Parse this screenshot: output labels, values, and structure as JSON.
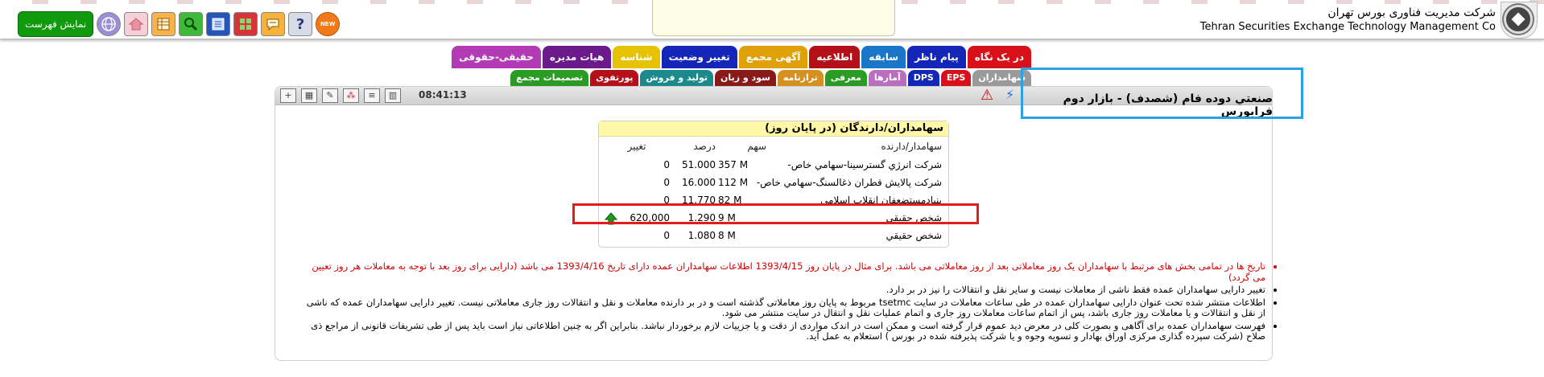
{
  "header": {
    "company_fa": "شرکت مدیریت فناوری بورس تهران",
    "company_en": "Tehran Securities Exchange Technology Management Co",
    "show_list": "نمایش فهرست",
    "new_badge": "NEW",
    "help_icon": "?"
  },
  "tabs_row1": [
    {
      "label": "در یک نگاه",
      "color": "#d8101a"
    },
    {
      "label": "پیام ناظر",
      "color": "#1426b8"
    },
    {
      "label": "سابقه",
      "color": "#1976c8"
    },
    {
      "label": "اطلاعیه",
      "color": "#b3101a"
    },
    {
      "label": "آگهی مجمع",
      "color": "#e0a008"
    },
    {
      "label": "تغییر وضعیت",
      "color": "#1426b8"
    },
    {
      "label": "شناسه",
      "color": "#e6c200"
    },
    {
      "label": "هیات مدیره",
      "color": "#6a1a8a"
    },
    {
      "label": "حقیقی-حقوقی",
      "color": "#b23bb5"
    }
  ],
  "tabs_row2": [
    {
      "label": "سهامداران",
      "color": "#9a9a9a"
    },
    {
      "label": "EPS",
      "color": "#d8101a"
    },
    {
      "label": "DPS",
      "color": "#1426b8"
    },
    {
      "label": "آمارها",
      "color": "#b96ec0"
    },
    {
      "label": "معرفی",
      "color": "#2a9c23"
    },
    {
      "label": "ترازنامه",
      "color": "#d6901f"
    },
    {
      "label": "سود و زیان",
      "color": "#8a1a1a"
    },
    {
      "label": "تولید و فروش",
      "color": "#1a8a8a"
    },
    {
      "label": "پورتفوی",
      "color": "#b3101a"
    },
    {
      "label": "تصمیمات مجمع",
      "color": "#2a9c23"
    }
  ],
  "instrument": {
    "title": "صنعتي دوده فام (شصدف) - بازار دوم فرابورس",
    "time": "08:41:13"
  },
  "holders": {
    "title": "سهامداران/دارندگان (در پایان روز)",
    "col_holder": "سهامدار/دارنده",
    "col_share": "سهم",
    "col_pct": "درصد",
    "col_change": "تغییر",
    "rows": [
      {
        "name": "شرکت انرژي گسترسينا-سهامي خاص-",
        "share": "357 M",
        "pct": "51.000",
        "change": "0"
      },
      {
        "name": "شرکت پالايش قطران ذغالسنگ-سهامي خاص-",
        "share": "112 M",
        "pct": "16.000",
        "change": "0"
      },
      {
        "name": "بنيادمستضعفان انقلاب اسلامي",
        "share": "82 M",
        "pct": "11.770",
        "change": "0"
      },
      {
        "name": "شخص حقيقي",
        "share": "9 M",
        "pct": "1.290",
        "change": "620,000"
      },
      {
        "name": "شخص حقيقي",
        "share": "8 M",
        "pct": "1.080",
        "change": "0"
      }
    ]
  },
  "notes": [
    "تاریخ ها در تمامی بخش های مرتبط با سهامداران یک روز معاملاتی بعد از روز معاملاتی می باشد. برای مثال در پایان روز 1393/4/15 اطلاعات سهامداران عمده دارای تاریخ 1393/4/16 می باشد (دارایی برای روز بعد با توجه به معاملات هر روز تعیین می گردد)",
    "تغییر دارایی سهامداران عمده فقط ناشی از معاملات نیست و سایر نقل و انتقالات را نیز در بر دارد.",
    "اطلاعات منتشر شده تحت عنوان دارایی سهامداران عمده در طی ساعات معاملات در سایت tsetmc مربوط به پایان روز معاملاتی گذشته است و در بر دارنده معاملات و نقل و انتقالات روز جاری معاملاتی نیست. تغییر دارایی سهامداران عمده که ناشی از نقل و انتقالات و یا معاملات روز جاری باشد، پس از اتمام ساعات معاملات روز جاری و اتمام عملیات نقل و انتقال در سایت منتشر می شود.",
    "فهرست سهامداران عمده برای آگاهی و بصورت کلی در معرض دید عموم قرار گرفته است و ممکن است در اندک مواردی از دقت و یا جزییات لازم برخوردار نباشد. بنابراین اگر به چنین اطلاعاتی نیاز است باید پس از طی تشریفات قانونی از مراجع ذی صلاح (شرکت سپرده گذاری مرکزی اوراق بهادار و تسویه وجوه و یا شرکت پذیرفته شده در بورس ) استعلام به عمل آید."
  ]
}
